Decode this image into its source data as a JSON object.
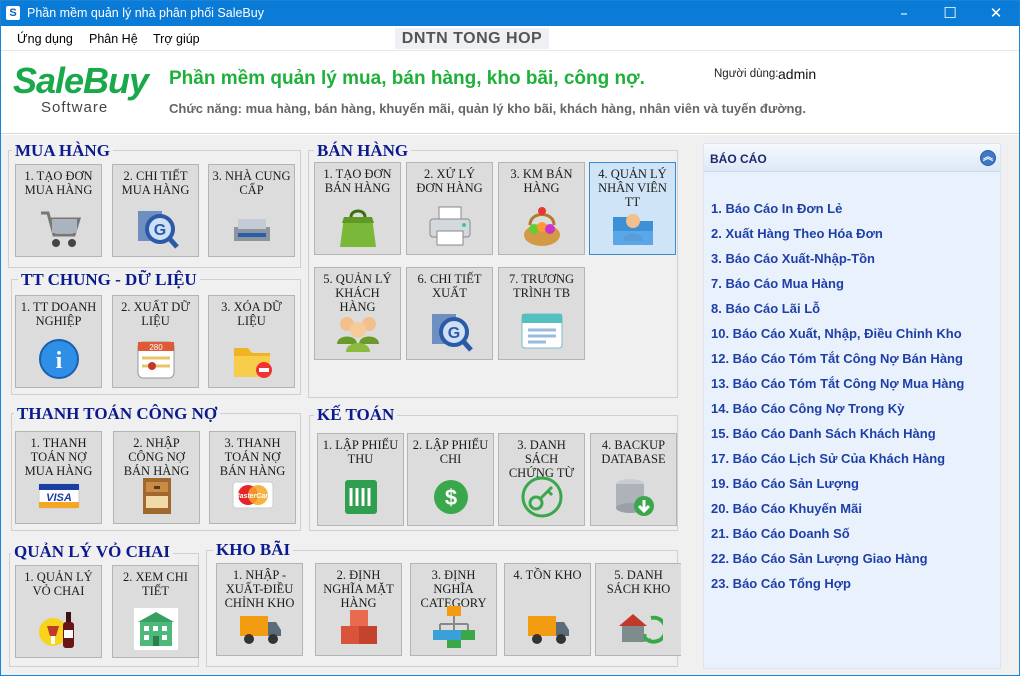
{
  "window": {
    "title": "Phần mềm quản lý nhà phân phối SaleBuy",
    "app_icon": "S",
    "minimize": "–",
    "maximize": "☐",
    "close": "✕"
  },
  "menu": {
    "items": [
      "Ứng dụng",
      "Phân Hệ",
      "Trợ giúp"
    ],
    "caption": "DNTN  TONG HOP"
  },
  "header": {
    "logo_main": "SaleBuy",
    "logo_sub": "Software",
    "title": "Phần mềm quản lý mua, bán hàng, kho bãi, công nợ.",
    "subtitle": "Chức năng: mua hàng, bán hàng, khuyến mãi, quản lý kho bãi, khách hàng, nhân viên và tuyến đường.",
    "user_label": "Người dùng:",
    "user_value": "admin"
  },
  "groups": {
    "mua_hang": {
      "title": "MUA HÀNG",
      "tiles": [
        "1. TẠO ĐƠN MUA HÀNG",
        "2. CHI TIẾT MUA HÀNG",
        "3. NHÀ CUNG CẤP"
      ]
    },
    "ban_hang": {
      "title": "BÁN HÀNG",
      "tiles": [
        "1. TẠO ĐƠN BÁN HÀNG",
        "2. XỬ LÝ ĐƠN HÀNG",
        "3. KM BÁN HÀNG",
        "4. QUẢN LÝ NHÂN VIÊN TT",
        "5. QUẢN LÝ KHÁCH HÀNG",
        "6. CHI TIẾT XUẤT",
        "7. TRƯƠNG TRÌNH TB"
      ]
    },
    "tt_chung": {
      "title": "TT CHUNG - DỮ LIỆU",
      "tiles": [
        "1. TT DOANH NGHIỆP",
        "2. XUẤT DỮ LIỆU",
        "3. XÓA DỮ LIỆU"
      ]
    },
    "thanh_toan": {
      "title": "THANH TOÁN CÔNG NỢ",
      "tiles": [
        "1. THANH TOÁN NỢ MUA HÀNG",
        "2. NHẬP CÔNG NỢ BÁN HÀNG",
        "3. THANH TOÁN NỢ BÁN HÀNG"
      ]
    },
    "ke_toan": {
      "title": "KẾ TOÁN",
      "tiles": [
        "1. LẬP PHIẾU THU",
        "2. LẬP PHIẾU CHI",
        "3. DANH SÁCH CHỨNG TỪ",
        "4. BACKUP DATABASE"
      ]
    },
    "vo_chai": {
      "title": "QUẢN LÝ VỎ CHAI",
      "tiles": [
        "1. QUẢN LÝ VỎ CHAI",
        "2. XEM CHI TIẾT"
      ]
    },
    "kho_bai": {
      "title": "KHO BÃI",
      "tiles": [
        "1. NHẬP - XUẤT-ĐIỀU CHỈNH KHO",
        "2. ĐỊNH NGHĨA MẶT HÀNG",
        "3. ĐỊNH NGHĨA CATEGORY",
        "4. TỒN KHO",
        "5. DANH SÁCH KHO"
      ]
    }
  },
  "visa_text": "VISA",
  "mc_text": "MasterCard",
  "calendar_text": "280",
  "info_text": "i",
  "reports": {
    "title": "BÁO CÁO",
    "collapse_icon": "︽",
    "items": [
      "1. Báo Cáo In Đơn Lẻ",
      "2. Xuất Hàng Theo Hóa Đơn",
      "3. Báo Cáo Xuất-Nhập-Tồn",
      "7. Báo Cáo Mua Hàng",
      "8. Báo Cáo Lãi Lỗ",
      "10. Báo Cáo Xuất, Nhập, Điều Chỉnh Kho",
      "12. Báo Cáo Tóm Tắt Công Nợ Bán Hàng",
      "13. Báo Cáo Tóm Tắt Công Nợ Mua Hàng",
      "14. Báo Cáo Công Nợ Trong Kỳ",
      "15. Báo Cáo Danh Sách Khách Hàng",
      "17. Báo Cáo Lịch Sử Của Khách Hàng",
      "19. Báo Cáo Sản Lượng",
      "20. Báo Cáo Khuyến Mãi",
      "21. Báo Cáo Doanh Số",
      "22. Báo Cáo Sản Lượng Giao Hàng",
      "23. Báo Cáo Tổng Hợp"
    ]
  },
  "colors": {
    "titlebar": "#0a7bd6",
    "accent_green": "#1fb03a",
    "group_title": "#0b1a8c",
    "report_link": "#1f3fa8"
  }
}
